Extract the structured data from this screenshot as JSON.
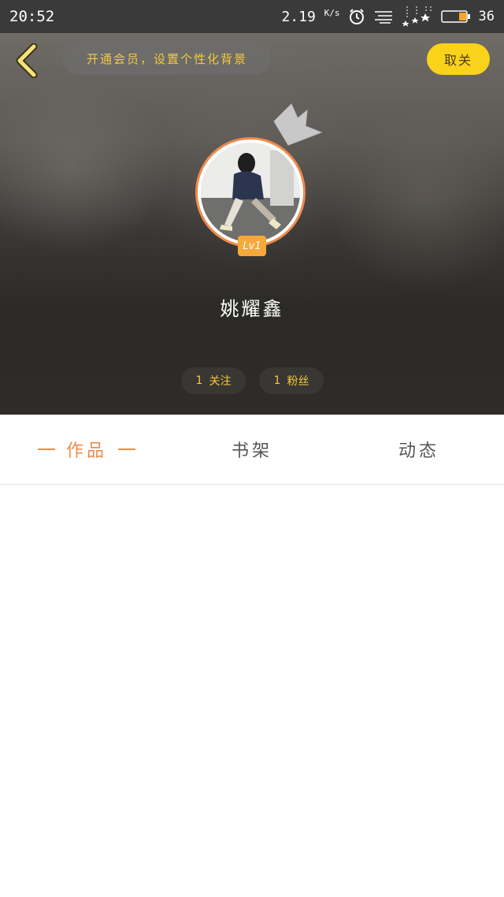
{
  "status_bar": {
    "time": "20:52",
    "net_speed": "2.19",
    "net_unit": "K/s",
    "battery": "36",
    "icons": [
      "alarm-icon",
      "menu-lines-icon",
      "signal-icon",
      "battery-icon"
    ]
  },
  "header": {
    "vip_banner": "开通会员，设置个性化背景",
    "follow_label": "取关",
    "level": "Lv1",
    "username": "姚耀鑫",
    "following_count": "1",
    "following_label": "关注",
    "fans_count": "1",
    "fans_label": "粉丝"
  },
  "tabs": [
    {
      "label": "作品",
      "active": true
    },
    {
      "label": "书架",
      "active": false
    },
    {
      "label": "动态",
      "active": false
    }
  ],
  "colors": {
    "accent_orange": "#f08a4b",
    "accent_yellow": "#f9d21a",
    "banner_text": "#f3c93f",
    "status_bar_bg": "#3a3a3a"
  }
}
